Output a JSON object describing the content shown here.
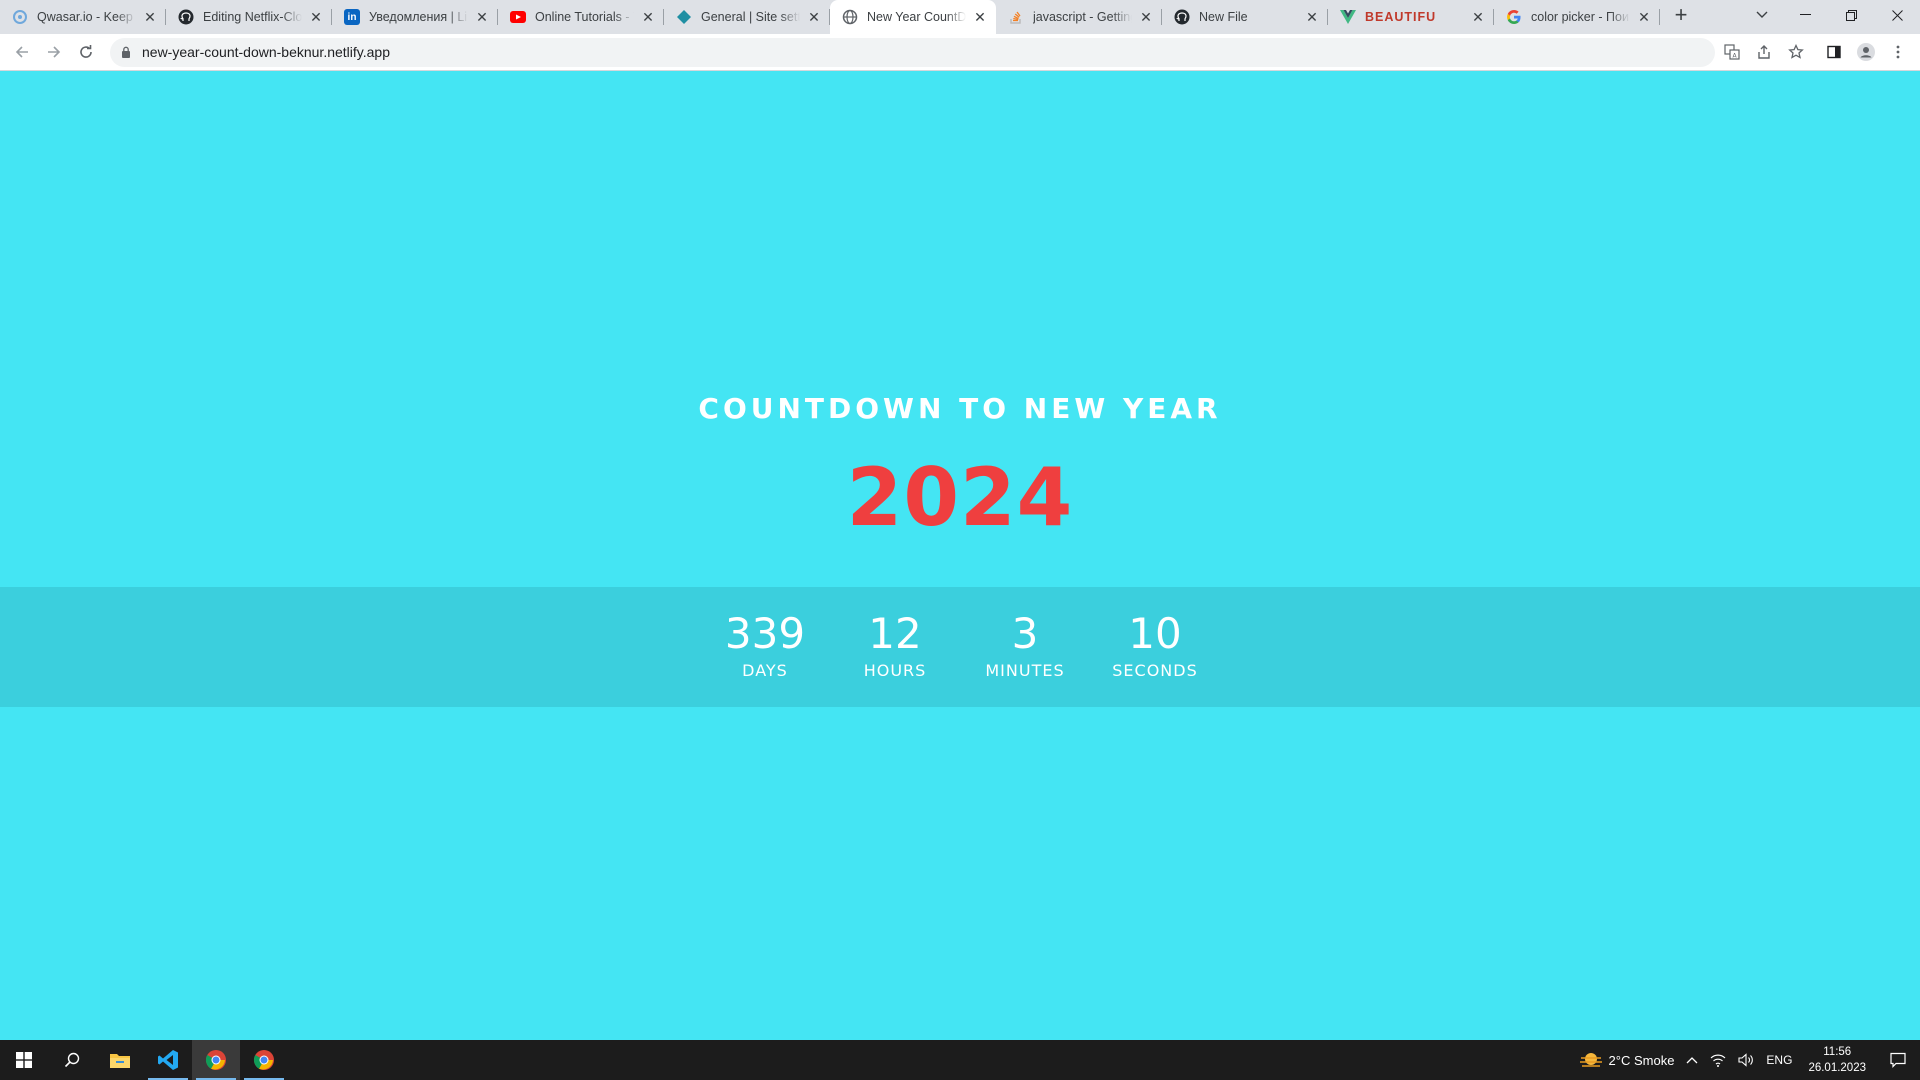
{
  "browser": {
    "tabs": [
      {
        "title": "Qwasar.io - Keep G",
        "icon": "qwasar-icon",
        "active": false
      },
      {
        "title": "Editing Netflix-Clon",
        "icon": "github-icon",
        "active": false
      },
      {
        "title": "Уведомления | Lin",
        "icon": "linkedin-icon",
        "active": false
      },
      {
        "title": "Online Tutorials - Y",
        "icon": "youtube-icon",
        "active": false
      },
      {
        "title": "General | Site settin",
        "icon": "netlify-icon",
        "active": false
      },
      {
        "title": "New Year CountDo",
        "icon": "globe-icon",
        "active": true
      },
      {
        "title": "javascript - Getting",
        "icon": "stackoverflow-icon",
        "active": false
      },
      {
        "title": "New File",
        "icon": "github-icon",
        "active": false
      },
      {
        "title": "BEAUTIFU",
        "icon": "vue-icon",
        "active": false
      },
      {
        "title": "color picker - Пои",
        "icon": "google-icon",
        "active": false
      }
    ],
    "new_tab_symbol": "+",
    "url": "new-year-count-down-beknur.netlify.app"
  },
  "page": {
    "heading": "COUNTDOWN TO NEW YEAR",
    "year": "2024",
    "countdown": [
      {
        "value": "339",
        "label": "DAYS"
      },
      {
        "value": "12",
        "label": "HOURS"
      },
      {
        "value": "3",
        "label": "MINUTES"
      },
      {
        "value": "10",
        "label": "SECONDS"
      }
    ]
  },
  "taskbar": {
    "weather": "2°C  Smoke",
    "language": "ENG",
    "time": "11:56",
    "date": "26.01.2023"
  },
  "colors": {
    "page_background": "#44e5f3",
    "band_background": "#3bcfdd",
    "year_color": "#ef3f3f",
    "heading_color": "#ffffff"
  }
}
